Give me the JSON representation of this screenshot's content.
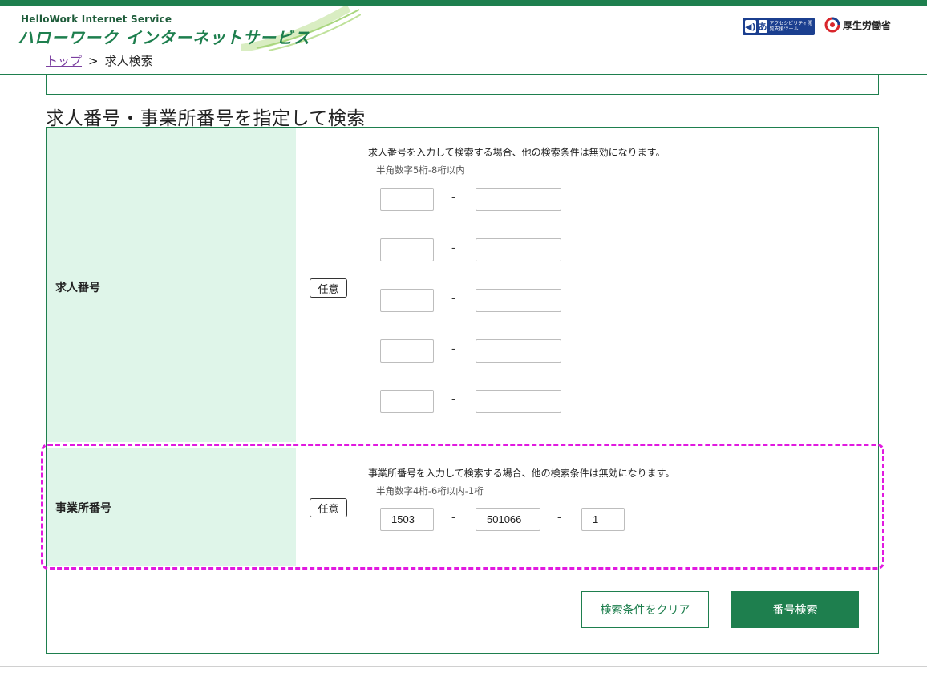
{
  "header": {
    "logo_en": "HelloWork Internet Service",
    "logo_jp": "ハローワーク インターネットサービス",
    "accessibility_badge_text": "アクセシビリティ閲覧支援ツール",
    "accessibility_icon1": "speaker-icon",
    "accessibility_icon2": "あ",
    "ministry_name": "厚生労働省"
  },
  "breadcrumb": {
    "top": "トップ",
    "separator": ">",
    "current": "求人検索"
  },
  "section": {
    "title": "求人番号・事業所番号を指定して検索"
  },
  "job_number": {
    "label": "求人番号",
    "badge": "任意",
    "note": "求人番号を入力して検索する場合、他の検索条件は無効になります。",
    "hint": "半角数字5桁-8桁以内",
    "dash": "-",
    "rows": [
      {
        "part1": "",
        "part2": ""
      },
      {
        "part1": "",
        "part2": ""
      },
      {
        "part1": "",
        "part2": ""
      },
      {
        "part1": "",
        "part2": ""
      },
      {
        "part1": "",
        "part2": ""
      }
    ]
  },
  "office_number": {
    "label": "事業所番号",
    "badge": "任意",
    "note": "事業所番号を入力して検索する場合、他の検索条件は無効になります。",
    "hint": "半角数字4桁-6桁以内-1桁",
    "dash": "-",
    "part1": "1503",
    "part2": "501066",
    "part3": "1"
  },
  "buttons": {
    "clear": "検索条件をクリア",
    "search": "番号検索"
  },
  "colors": {
    "brand_green": "#1e7f4e",
    "label_bg": "#dff5e9",
    "highlight": "#e11ae0"
  }
}
